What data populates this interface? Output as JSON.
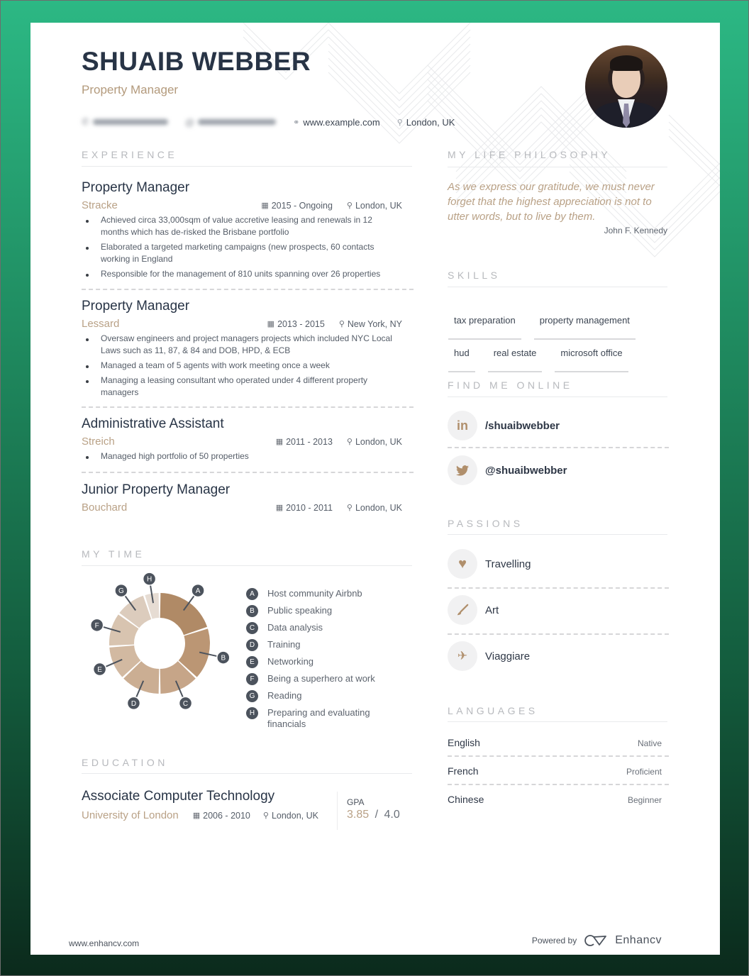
{
  "header": {
    "name": "SHUAIB WEBBER",
    "role": "Property Manager",
    "contacts": {
      "phone_icon": "phone-icon",
      "email_icon": "at-icon",
      "website_icon": "link-icon",
      "website": "www.example.com",
      "location_icon": "map-pin-icon",
      "location": "London, UK"
    },
    "photo_alt": "profile photo"
  },
  "experience": {
    "title": "EXPERIENCE",
    "jobs": [
      {
        "title": "Property Manager",
        "company": "Stracke",
        "dates": "2015 - Ongoing",
        "location": "London, UK",
        "bullets": [
          "Achieved circa 33,000sqm of value accretive leasing and renewals in 12 months which has de-risked the Brisbane portfolio",
          "Elaborated a targeted marketing campaigns (new prospects, 60 contacts working in England",
          "Responsible for the management of 810 units spanning over 26 properties"
        ]
      },
      {
        "title": "Property Manager",
        "company": "Lessard",
        "dates": "2013 - 2015",
        "location": "New York, NY",
        "bullets": [
          "Oversaw engineers and project managers projects which included NYC Local Laws such as 11, 87, & 84 and DOB, HPD, & ECB",
          "Managed a team of 5 agents with work meeting once a week",
          "Managing a leasing consultant who operated under 4 different property managers"
        ]
      },
      {
        "title": "Administrative Assistant",
        "company": "Streich",
        "dates": "2011 - 2013",
        "location": "London, UK",
        "bullets": [
          "Managed high portfolio of 50 properties"
        ]
      },
      {
        "title": "Junior Property Manager",
        "company": "Bouchard",
        "dates": "2010 - 2011",
        "location": "London, UK",
        "bullets": []
      }
    ]
  },
  "my_time": {
    "title": "MY TIME",
    "chart_data": {
      "type": "pie",
      "title": "MY TIME",
      "style": "donut",
      "categories": [
        "A",
        "B",
        "C",
        "D",
        "E",
        "F",
        "G",
        "H"
      ],
      "labels": [
        "Host community Airbnb",
        "Public speaking",
        "Data analysis",
        "Training",
        "Networking",
        "Being a superhero at work",
        "Reading",
        "Preparing and evaluating financials"
      ],
      "values": [
        20,
        17,
        13,
        13,
        11,
        11,
        10,
        5
      ],
      "colors": [
        "#b08a66",
        "#bb9674",
        "#c6a588",
        "#cbae93",
        "#d2b9a1",
        "#d8c4b0",
        "#dcccbd",
        "#e6dcd3"
      ],
      "legend": "right"
    }
  },
  "education": {
    "title": "EDUCATION",
    "degree": "Associate Computer Technology",
    "school": "University of London",
    "dates": "2006 - 2010",
    "location": "London, UK",
    "gpa_label": "GPA",
    "gpa_value": "3.85",
    "gpa_sep": "/",
    "gpa_max": "4.0"
  },
  "philosophy": {
    "title": "MY LIFE PHILOSOPHY",
    "quote": "As we express our gratitude, we must never forget that the highest appreciation is not to utter words, but to live by them.",
    "author": "John F. Kennedy"
  },
  "skills": {
    "title": "SKILLS",
    "items": [
      "tax preparation",
      "property management",
      "hud",
      "real estate",
      "microsoft office"
    ]
  },
  "online": {
    "title": "FIND ME ONLINE",
    "items": [
      {
        "icon": "linkedin-icon",
        "glyph": "in",
        "handle": "/shuaibwebber"
      },
      {
        "icon": "twitter-icon",
        "glyph": "",
        "handle": "@shuaibwebber"
      }
    ]
  },
  "passions": {
    "title": "PASSIONS",
    "items": [
      {
        "icon": "heart-icon",
        "label": "Travelling"
      },
      {
        "icon": "paintbrush-icon",
        "label": "Art"
      },
      {
        "icon": "airplane-icon",
        "label": "Viaggiare"
      }
    ]
  },
  "languages": {
    "title": "LANGUAGES",
    "items": [
      {
        "name": "English",
        "level": "Native"
      },
      {
        "name": "French",
        "level": "Proficient"
      },
      {
        "name": "Chinese",
        "level": "Beginner"
      }
    ]
  },
  "footer": {
    "site": "www.enhancv.com",
    "powered_by": "Powered by",
    "brand": "Enhancv"
  },
  "theme": {
    "accent": "#b9a186",
    "heading": "#283446",
    "background_top": "#2cb884",
    "background_bottom": "#0b2a1c"
  }
}
